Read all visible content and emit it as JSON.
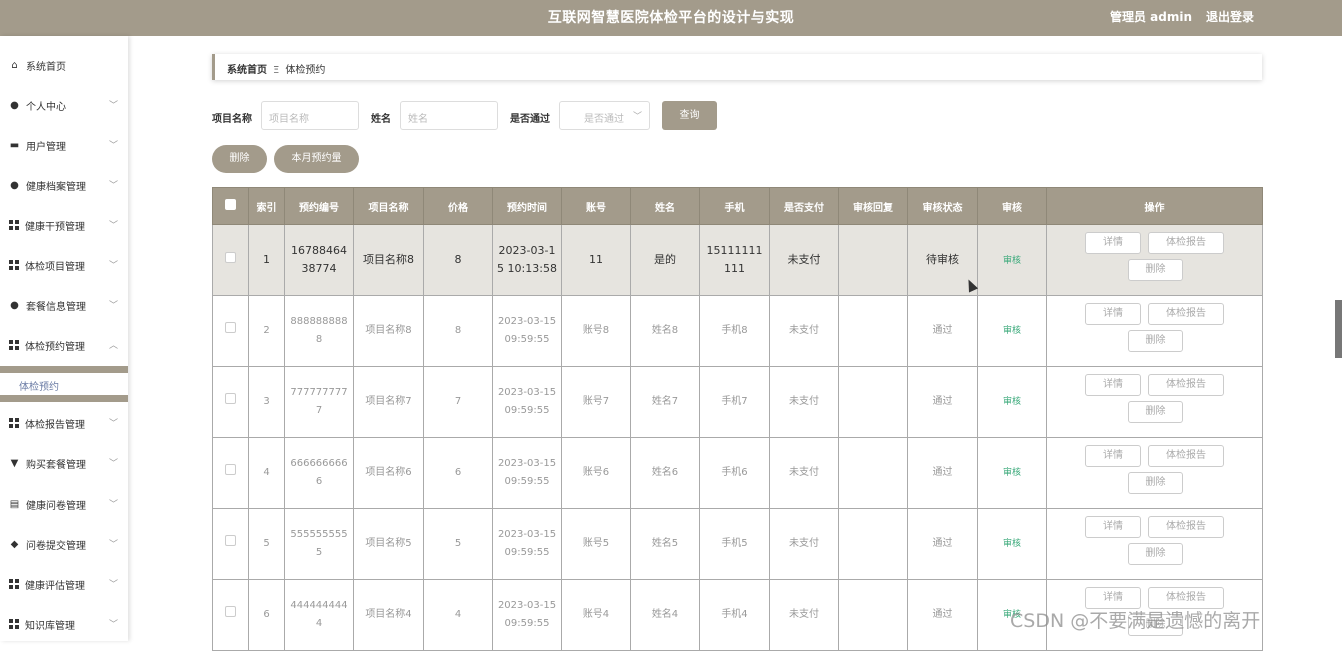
{
  "header": {
    "title": "互联网智慧医院体检平台的设计与实现",
    "user": "管理员 admin",
    "logout": "退出登录"
  },
  "sidebar": {
    "items": [
      {
        "label": "系统首页",
        "icon": "home-icon"
      },
      {
        "label": "个人中心",
        "icon": "user-icon"
      },
      {
        "label": "用户管理",
        "icon": "briefcase-icon"
      },
      {
        "label": "健康档案管理",
        "icon": "user-icon"
      },
      {
        "label": "健康干预管理",
        "icon": "grid-icon"
      },
      {
        "label": "体检项目管理",
        "icon": "grid-icon"
      },
      {
        "label": "套餐信息管理",
        "icon": "user-icon"
      },
      {
        "label": "体检预约管理",
        "icon": "grid-icon"
      },
      {
        "label": "体检报告管理",
        "icon": "grid-icon"
      },
      {
        "label": "购买套餐管理",
        "icon": "cup-icon"
      },
      {
        "label": "健康问卷管理",
        "icon": "notebook-icon"
      },
      {
        "label": "问卷提交管理",
        "icon": "pin-icon"
      },
      {
        "label": "健康评估管理",
        "icon": "grid-icon"
      },
      {
        "label": "知识库管理",
        "icon": "grid-icon"
      }
    ],
    "active_sub": "体检预约"
  },
  "breadcrumb": {
    "home": "系统首页",
    "sep": "Ξ",
    "current": "体检预约"
  },
  "search": {
    "project_label": "项目名称",
    "project_placeholder": "项目名称",
    "name_label": "姓名",
    "name_placeholder": "姓名",
    "pass_label": "是否通过",
    "pass_placeholder": "是否通过",
    "query": "查询"
  },
  "actions": {
    "delete": "删除",
    "monthly": "本月预约量"
  },
  "table": {
    "headers": [
      "",
      "索引",
      "预约编号",
      "项目名称",
      "价格",
      "预约时间",
      "账号",
      "姓名",
      "手机",
      "是否支付",
      "审核回复",
      "审核状态",
      "审核",
      "操作"
    ],
    "audit_label": "审核",
    "ops": {
      "detail": "详情",
      "report": "体检报告",
      "delete": "删除"
    },
    "rows": [
      {
        "idx": "1",
        "no": "1678846438774",
        "project": "项目名称8",
        "price": "8",
        "time": "2023-03-15 10:13:58",
        "account": "11",
        "name": "是的",
        "phone": "15111111111",
        "paid": "未支付",
        "reply": "",
        "status": "待审核"
      },
      {
        "idx": "2",
        "no": "8888888888",
        "project": "项目名称8",
        "price": "8",
        "time": "2023-03-15 09:59:55",
        "account": "账号8",
        "name": "姓名8",
        "phone": "手机8",
        "paid": "未支付",
        "reply": "",
        "status": "通过"
      },
      {
        "idx": "3",
        "no": "7777777777",
        "project": "项目名称7",
        "price": "7",
        "time": "2023-03-15 09:59:55",
        "account": "账号7",
        "name": "姓名7",
        "phone": "手机7",
        "paid": "未支付",
        "reply": "",
        "status": "通过"
      },
      {
        "idx": "4",
        "no": "6666666666",
        "project": "项目名称6",
        "price": "6",
        "time": "2023-03-15 09:59:55",
        "account": "账号6",
        "name": "姓名6",
        "phone": "手机6",
        "paid": "未支付",
        "reply": "",
        "status": "通过"
      },
      {
        "idx": "5",
        "no": "5555555555",
        "project": "项目名称5",
        "price": "5",
        "time": "2023-03-15 09:59:55",
        "account": "账号5",
        "name": "姓名5",
        "phone": "手机5",
        "paid": "未支付",
        "reply": "",
        "status": "通过"
      },
      {
        "idx": "6",
        "no": "4444444444",
        "project": "项目名称4",
        "price": "4",
        "time": "2023-03-15 09:59:55",
        "account": "账号4",
        "name": "姓名4",
        "phone": "手机4",
        "paid": "未支付",
        "reply": "",
        "status": "通过"
      }
    ]
  },
  "watermark": "CSDN @不要满是遗憾的离开",
  "colors": {
    "primary": "#a39b8b",
    "audit": "#3aa97a",
    "highlight_row": "#e6e4df"
  }
}
